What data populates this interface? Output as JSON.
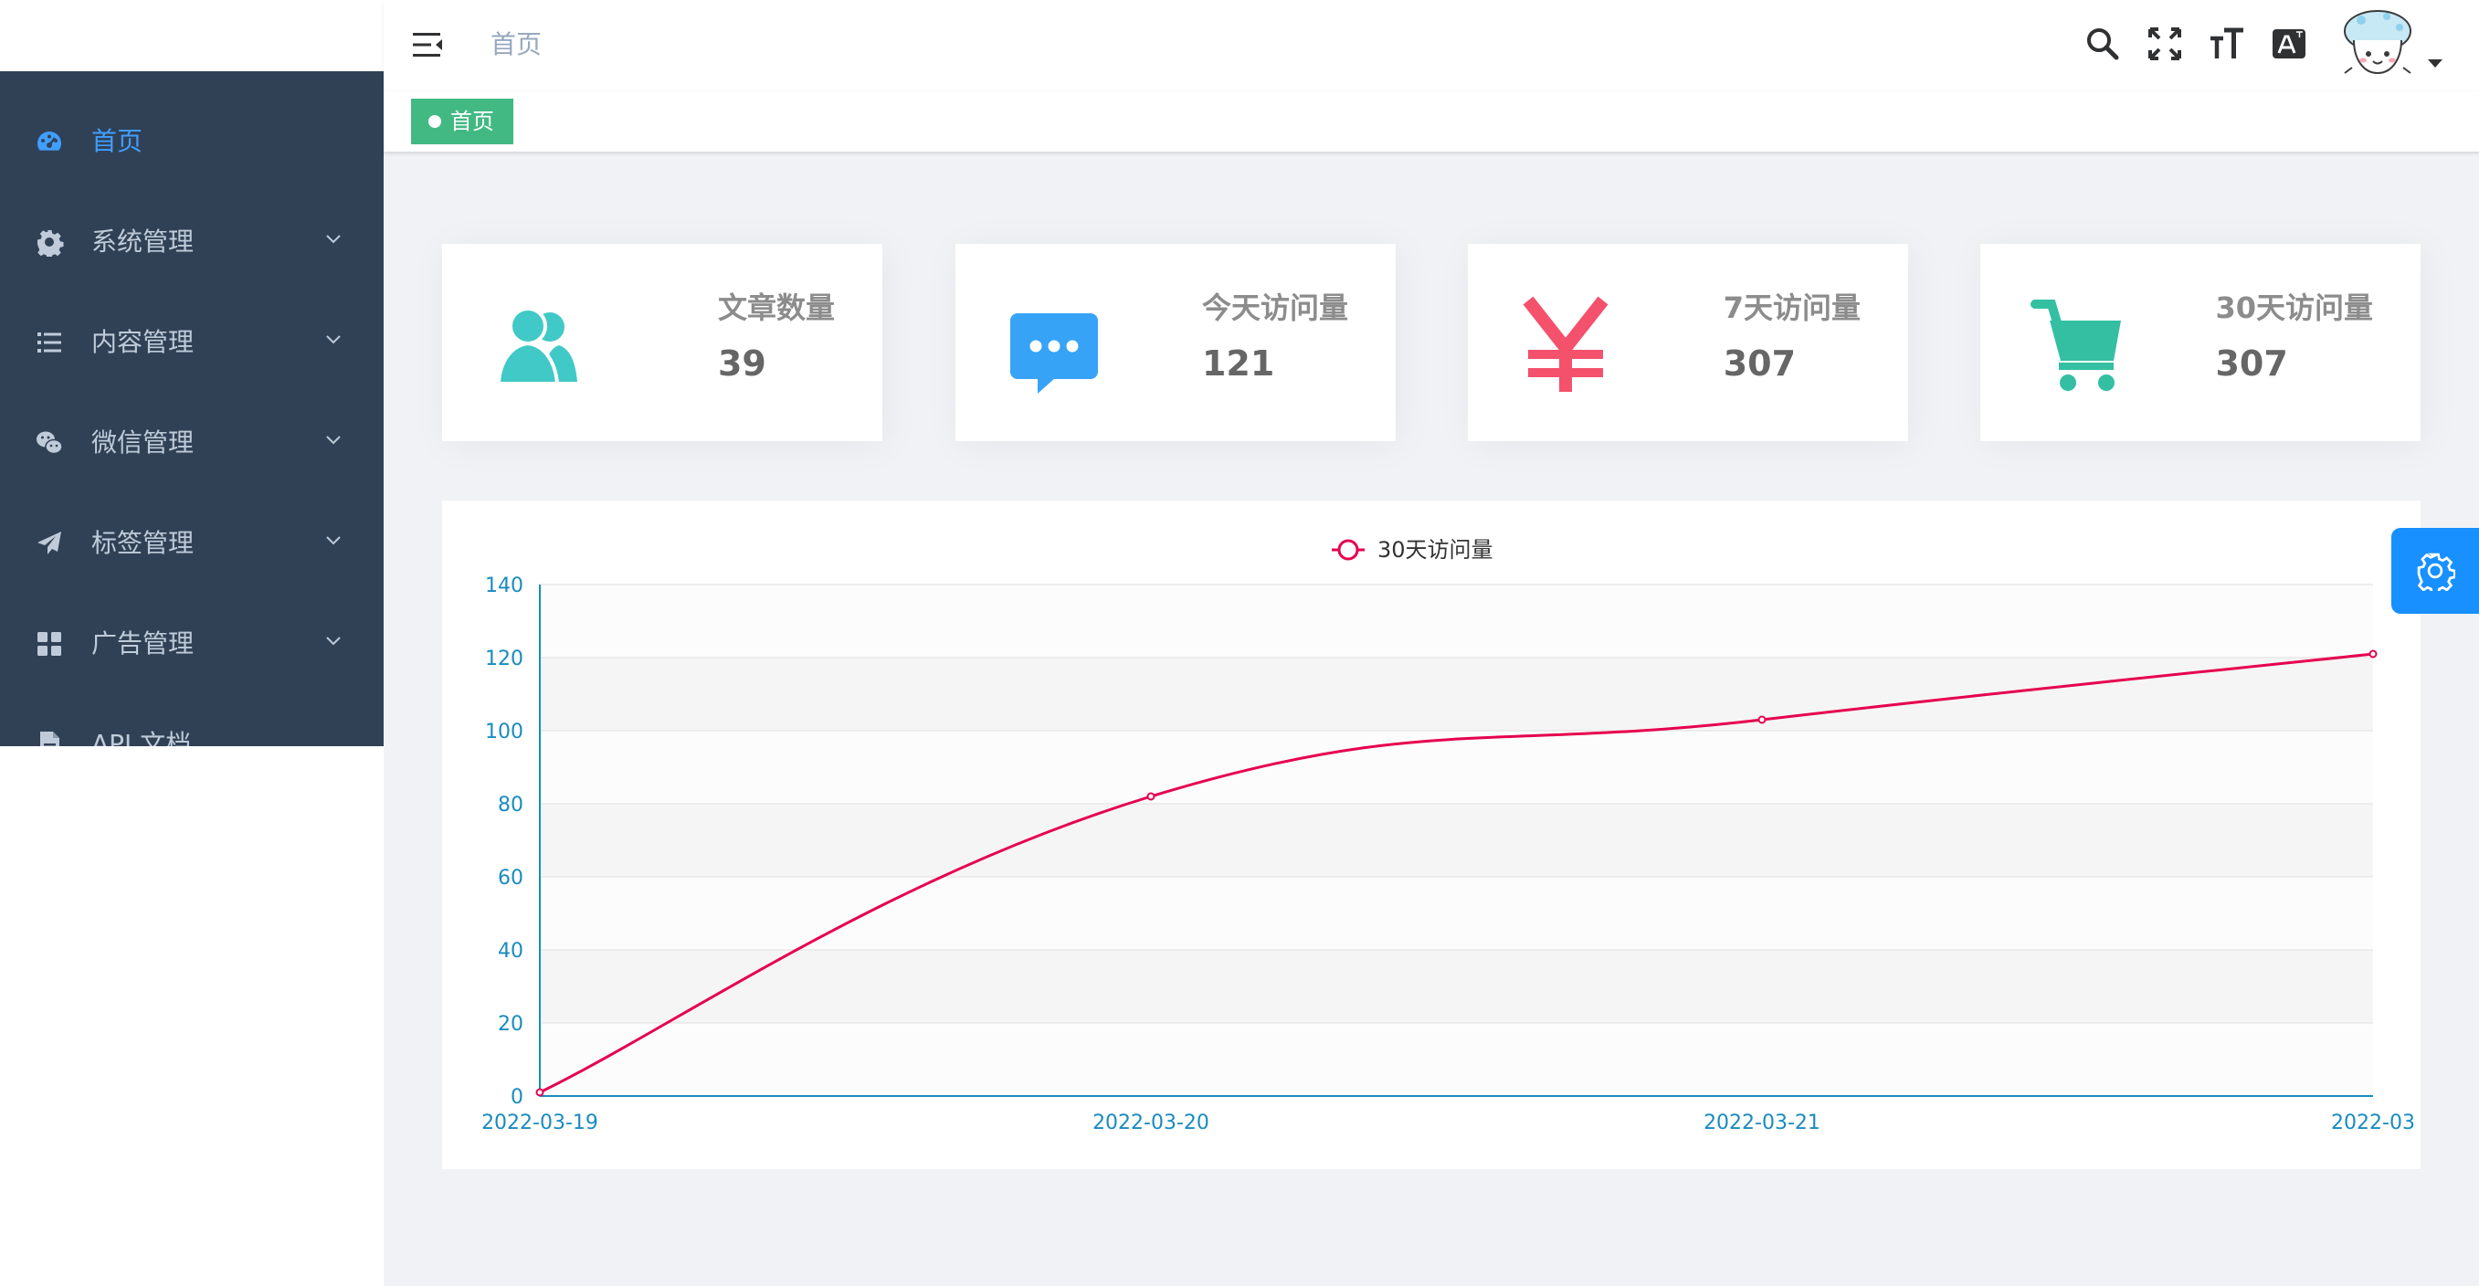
{
  "sidebar": {
    "items": [
      {
        "label": "首页",
        "icon": "dashboard-icon",
        "active": true
      },
      {
        "label": "系统管理",
        "icon": "gear-icon"
      },
      {
        "label": "内容管理",
        "icon": "list-icon"
      },
      {
        "label": "微信管理",
        "icon": "wechat-icon"
      },
      {
        "label": "标签管理",
        "icon": "paper-plane-icon"
      },
      {
        "label": "广告管理",
        "icon": "grid-icon"
      },
      {
        "label": "API 文档",
        "icon": "document-icon"
      }
    ]
  },
  "navbar": {
    "breadcrumb": "首页",
    "tools": [
      "search-icon",
      "fullscreen-icon",
      "font-size-icon",
      "language-icon"
    ]
  },
  "tags_view": {
    "tags": [
      {
        "label": "首页",
        "active": true
      }
    ]
  },
  "stats": [
    {
      "label": "文章数量",
      "value": "39",
      "icon": "users-icon",
      "color": "#40c9c6"
    },
    {
      "label": "今天访问量",
      "value": "121",
      "icon": "message-icon",
      "color": "#36a3f7"
    },
    {
      "label": "7天访问量",
      "value": "307",
      "icon": "yen-icon",
      "color": "#f4516c"
    },
    {
      "label": "30天访问量",
      "value": "307",
      "icon": "shopping-cart-icon",
      "color": "#34bfa3"
    }
  ],
  "colors": {
    "sidebar_bg": "#304156",
    "sidebar_text": "#bfcbd9",
    "sidebar_active": "#409eff",
    "tag_active": "#42b983",
    "line": "#e6004f",
    "axis": "#1a8bc0",
    "settings_btn": "#1890ff"
  },
  "chart_data": {
    "type": "line",
    "x": [
      "2022-03-19",
      "2022-03-20",
      "2022-03-21",
      "2022-03"
    ],
    "series": [
      {
        "name": "30天访问量",
        "values": [
          1,
          82,
          103,
          121
        ]
      }
    ],
    "ylim": [
      0,
      140
    ],
    "yticks": [
      0,
      20,
      40,
      60,
      80,
      100,
      120,
      140
    ],
    "smooth": true,
    "legend": "top-center",
    "grid": true
  }
}
